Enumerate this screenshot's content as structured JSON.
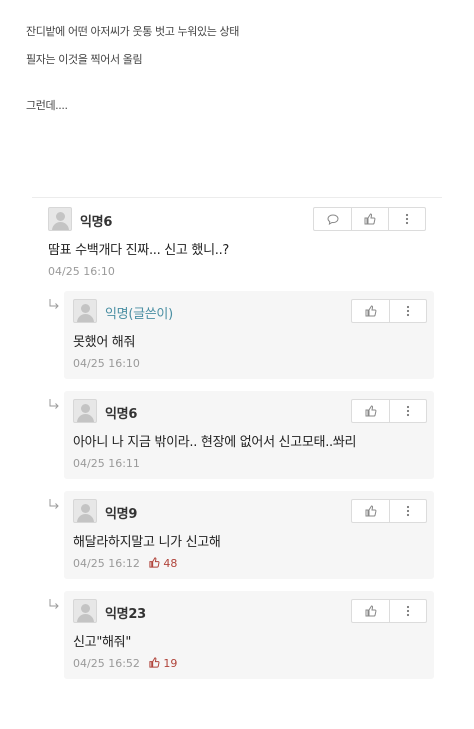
{
  "post": {
    "lines": [
      "잔디밭에 어떤 아저씨가 웃통 벗고 누워있는 상태",
      "필자는 이것을 찍어서 올림",
      "그런데...."
    ]
  },
  "icons": {
    "comment": "speech-bubble-icon",
    "like": "thumbs-up-icon",
    "more": "vertical-ellipsis-icon",
    "reply_indicator": "reply-arrow-icon",
    "avatar": "default-user-avatar"
  },
  "colors": {
    "author_nick": "#4a8fa3",
    "like_count": "#b0433a",
    "reply_background": "#f6f6f6"
  },
  "comments": [
    {
      "nickname": "익명6",
      "text": "땀표 수백개다 진짜... 신고 했니..?",
      "time": "04/25 16:10",
      "likes": ""
    },
    {
      "nickname": "익명(글쓴이)",
      "text": "못했어 해줘",
      "time": "04/25 16:10",
      "likes": ""
    },
    {
      "nickname": "익명6",
      "text": "아아니 나 지금 밖이라.. 현장에 없어서 신고모태..쏴리",
      "time": "04/25 16:11",
      "likes": ""
    },
    {
      "nickname": "익명9",
      "text": "해달라하지말고 니가 신고해",
      "time": "04/25 16:12",
      "likes": "48"
    },
    {
      "nickname": "익명23",
      "text": "신고\"해줘\"",
      "time": "04/25 16:52",
      "likes": "19"
    }
  ]
}
